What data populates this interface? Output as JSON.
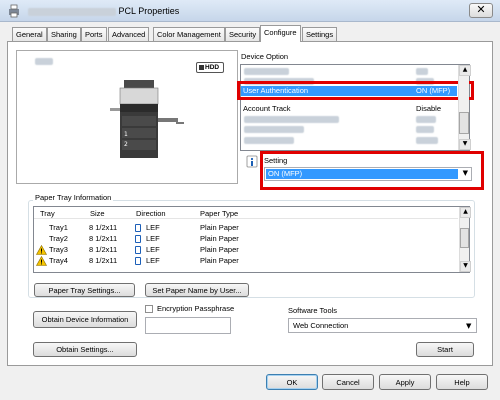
{
  "window": {
    "title_suffix": "PCL Properties",
    "close_glyph": "✕"
  },
  "tabs": [
    {
      "label": "General"
    },
    {
      "label": "Sharing"
    },
    {
      "label": "Ports"
    },
    {
      "label": "Advanced"
    },
    {
      "label": "Color Management"
    },
    {
      "label": "Security"
    },
    {
      "label": "Configure"
    },
    {
      "label": "Settings"
    }
  ],
  "preview": {
    "hdd_label": "HDD"
  },
  "device_option": {
    "label": "Device Option",
    "rows": [
      {
        "name": "User Authentication",
        "value": "ON (MFP)"
      },
      {
        "name": "Account Track",
        "value": "Disable"
      }
    ]
  },
  "setting": {
    "label": "Setting",
    "value": "ON (MFP)"
  },
  "paper_tray": {
    "label": "Paper Tray Information",
    "columns": [
      "Tray",
      "Size",
      "Direction",
      "Paper Type"
    ],
    "rows": [
      {
        "tray": "Tray1",
        "size": "8 1/2x11",
        "direction": "LEF",
        "type": "Plain Paper"
      },
      {
        "tray": "Tray2",
        "size": "8 1/2x11",
        "direction": "LEF",
        "type": "Plain Paper"
      },
      {
        "tray": "Tray3",
        "size": "8 1/2x11",
        "direction": "LEF",
        "type": "Plain Paper"
      },
      {
        "tray": "Tray4",
        "size": "8 1/2x11",
        "direction": "LEF",
        "type": "Plain Paper"
      }
    ]
  },
  "buttons": {
    "paper_tray_settings": "Paper Tray Settings...",
    "set_paper_name": "Set Paper Name by User...",
    "obtain_device_info": "Obtain Device Information",
    "obtain_settings": "Obtain Settings...",
    "start": "Start",
    "ok": "OK",
    "cancel": "Cancel",
    "apply": "Apply",
    "help": "Help"
  },
  "encryption": {
    "label": "Encryption Passphrase",
    "value": ""
  },
  "software_tools": {
    "label": "Software Tools",
    "value": "Web Connection"
  },
  "colors": {
    "highlight": "#3399ff",
    "red_frame": "#e00000"
  }
}
